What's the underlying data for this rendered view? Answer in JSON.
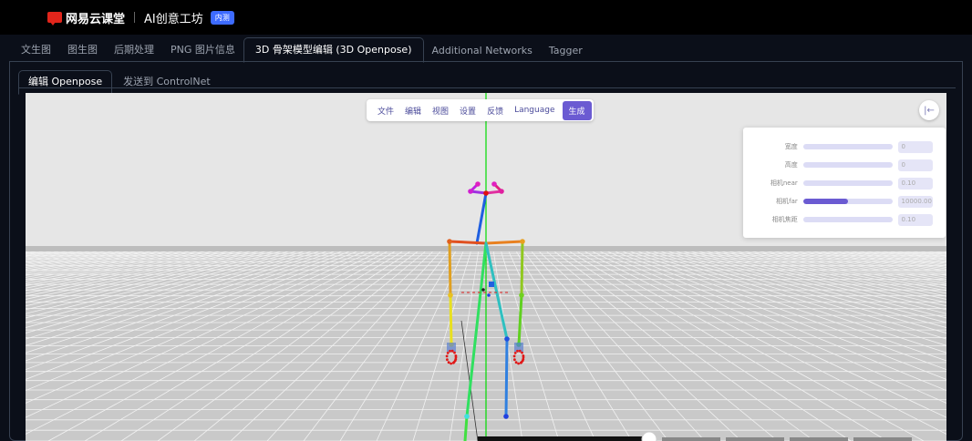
{
  "header": {
    "brand": "网易云课堂",
    "product": "AI创意工坊",
    "badge": "内测"
  },
  "tabs": [
    {
      "label": "文生图",
      "active": false
    },
    {
      "label": "图生图",
      "active": false
    },
    {
      "label": "后期处理",
      "active": false
    },
    {
      "label": "PNG 图片信息",
      "active": false
    },
    {
      "label": "3D 骨架模型编辑 (3D Openpose)",
      "active": true
    },
    {
      "label": "Additional Networks",
      "active": false
    },
    {
      "label": "Tagger",
      "active": false
    }
  ],
  "subtabs": [
    {
      "label": "编辑 Openpose",
      "active": true
    },
    {
      "label": "发送到 ControlNet",
      "active": false
    }
  ],
  "menu": {
    "file": "文件",
    "edit": "编辑",
    "view": "视图",
    "settings": "设置",
    "feedback": "反馈",
    "language": "Language",
    "generate": "生成"
  },
  "settings_panel": {
    "rows": [
      {
        "label": "宽度",
        "value": "0",
        "slider_fraction": 0
      },
      {
        "label": "高度",
        "value": "0",
        "slider_fraction": 0
      },
      {
        "label": "相机near",
        "value": "0.10",
        "slider_fraction": 0
      },
      {
        "label": "相机far",
        "value": "10000.00",
        "slider_fraction": 0.5
      },
      {
        "label": "相机焦距",
        "value": "0.10",
        "slider_fraction": 0
      }
    ]
  },
  "icons": {
    "logo": "netease-logo-icon",
    "collapse": "collapse-left-icon"
  },
  "colors": {
    "accent": "#6b5bd2",
    "badge": "#3d6bff",
    "brand_red": "#e1251b",
    "axis_green": "#00dd00"
  }
}
